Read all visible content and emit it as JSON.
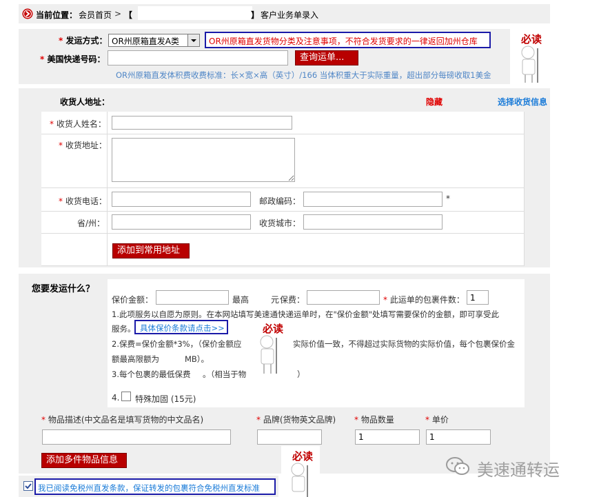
{
  "breadcrumb": {
    "label": "当前位置：",
    "home": "会员首页",
    "sep": ">",
    "bracket_open": "【",
    "bracket_close": "】",
    "current": "客户业务单录入"
  },
  "shipping": {
    "method_label": "发运方式：",
    "method_value": "OR州原箱直发A类",
    "notice": "OR州原箱直发货物分类及注意事项，不符合发货要求的一律返回加州仓库",
    "tracking_label": "美国快递号码：",
    "tracking_value": "",
    "query_button": "查询运单...",
    "fee_note": "OR州原箱直发体积费收费标准：长×宽×高（英寸）/166 当体积重大于实际重量，超出部分每磅收取1美金"
  },
  "badge": {
    "text": "必读"
  },
  "receiver": {
    "section_title": "收货人地址：",
    "hide_link": "隐藏",
    "select_link": "选择收货信息",
    "name_label": "收货人姓名：",
    "address_label": "收货地址：",
    "phone_label": "收货电话：",
    "zip_label": "邮政编码：",
    "state_label": "省/州：",
    "city_label": "收货城市：",
    "add_button": "添加到常用地址"
  },
  "goods": {
    "section_title": "您要发运什么？",
    "insured_label": "保价金额：",
    "max_label": "最高",
    "yuan_label": "元",
    "premium_label": "保费：",
    "count_label": "此运单的包裹件数：",
    "count_value": "1",
    "rule1a": "1.此项服务以自愿为原则。在本网站填写美速通快递运单时，在\"保价金额\"处填写需要保价的金额，即可享受此",
    "rule1b": "服务。",
    "rule1_link": "具体保价条款请点击>>",
    "rule2a": "2.保费=保价金额*3%，（保价金额应",
    "rule2a_tail": "实际价值一致，不得超过实际货物的实际价值，每个包裹保价金",
    "rule2b": "额最高限额为",
    "rule2b_tail": "MB）。",
    "rule3": "3.每个包裹的最低保费",
    "rule3_mid": "。（相当于物",
    "rule3_tail": "）",
    "special_index": "4.",
    "special_label": "特殊加固 (15元)"
  },
  "items": {
    "desc_label": "物品描述(中文品名是填写货物的中文品名)",
    "brand_label": "品牌(货物英文品牌)",
    "qty_label": "物品数量",
    "price_label": "单价",
    "qty_value": "1",
    "price_value": "1",
    "add_button": "添加多件物品信息"
  },
  "agreement": {
    "text": "我已阅读免税州直发条款，保证转发的包裹符合免税州直发标准",
    "checked": true
  },
  "watermark": {
    "text": "美速通转运"
  }
}
